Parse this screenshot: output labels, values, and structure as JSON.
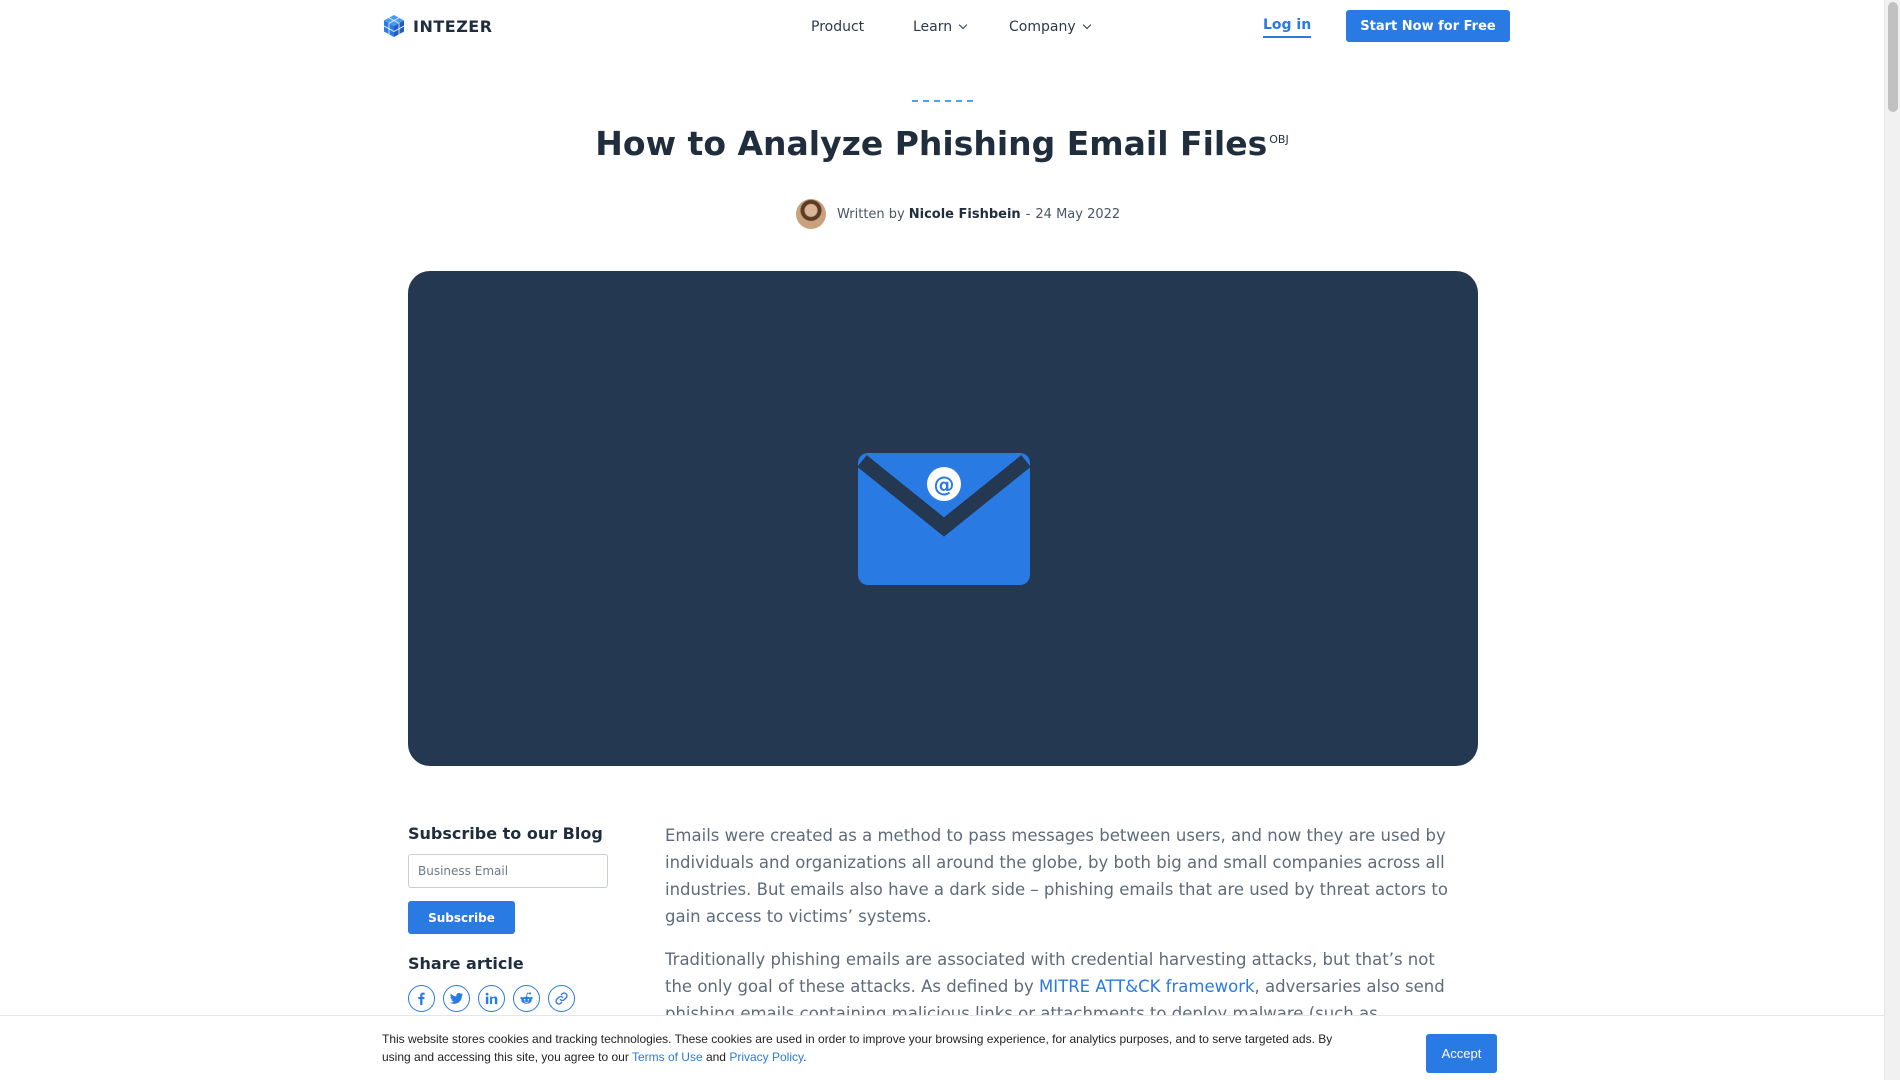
{
  "header": {
    "logo_text": "INTEZER",
    "nav": [
      {
        "label": "Product",
        "dropdown": false
      },
      {
        "label": "Learn",
        "dropdown": true
      },
      {
        "label": "Company",
        "dropdown": true
      }
    ],
    "login_label": "Log in",
    "cta_label": "Start Now for Free"
  },
  "article": {
    "title": "How to Analyze Phishing Email Files",
    "title_suffix": "OBJ",
    "byline_prefix": "Written by",
    "author": "Nicole Fishbein",
    "date_separator": "-",
    "date": "24 May 2022",
    "hero_icon": "envelope-at-icon",
    "paragraphs": {
      "p1": "Emails were created as a method to pass messages between users, and now they are used by individuals and organizations all around the globe, by both big and small companies across all industries. But emails also have a dark side – phishing emails that are used by threat actors to gain access to victims’ systems.",
      "p2_before": "Traditionally phishing emails are associated with credential harvesting attacks, but that’s not the only goal of these attacks. As defined by ",
      "p2_link": "MITRE ATT&CK framework",
      "p2_after": ", adversaries also send phishing emails containing malicious links or attachments to deploy malware (such as backdoors and ransomware) and further exploit the system."
    }
  },
  "sidebar": {
    "subscribe_title": "Subscribe to our Blog",
    "email_placeholder": "Business Email",
    "subscribe_label": "Subscribe",
    "share_title": "Share article",
    "share_icons": [
      "facebook-icon",
      "twitter-icon",
      "linkedin-icon",
      "reddit-icon",
      "link-icon"
    ]
  },
  "cookie": {
    "text_before": "This website stores cookies and tracking technologies. These cookies are used in order to improve your browsing experience, for analytics purposes, and to serve targeted ads. By using and accessing this site, you agree to our ",
    "terms_label": "Terms of Use",
    "and_text": " and ",
    "privacy_label": "Privacy Policy",
    "end_text": ".",
    "accept_label": "Accept"
  },
  "colors": {
    "brand_blue": "#2a7ae4",
    "hero_bg": "#243852",
    "title_text": "#1f2d3d"
  }
}
